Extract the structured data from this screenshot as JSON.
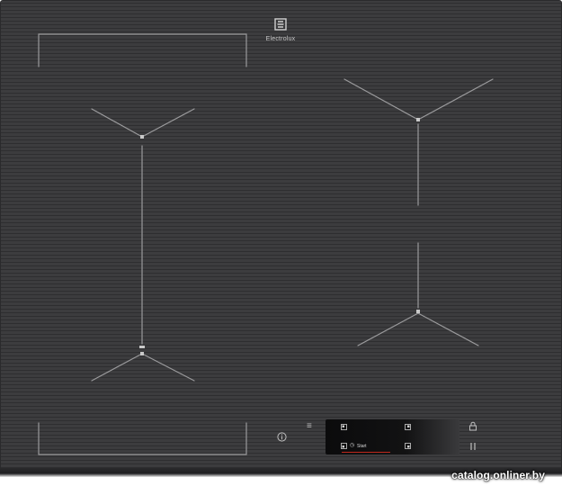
{
  "brand": {
    "name": "Electrolux",
    "logo_icon": "electrolux-logo-icon"
  },
  "controls": {
    "menu_icon": "menu-icon",
    "info_icon": "info-icon",
    "lock_icon": "lock-icon",
    "pause_icon": "pause-icon"
  },
  "display": {
    "start_label": "Start",
    "zone_icons": [
      "zone-top-left-icon",
      "zone-top-right-icon",
      "zone-bottom-left-icon",
      "zone-bottom-right-icon"
    ],
    "timer_icon": "timer-icon"
  },
  "watermark": {
    "text": "catalog.onliner.by"
  },
  "colors": {
    "glass": "#3a3a3c",
    "zone_lines": "#a9a9a9",
    "display": "#0b0b0c",
    "accent_red": "#c0281c"
  }
}
